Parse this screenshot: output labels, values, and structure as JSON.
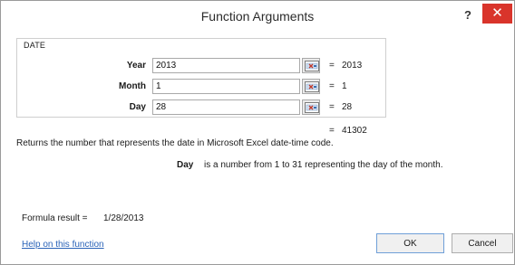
{
  "window": {
    "title": "Function Arguments",
    "help_glyph": "?",
    "close_glyph": "✕"
  },
  "function": {
    "name": "DATE",
    "args": [
      {
        "label": "Year",
        "value": "2013",
        "eq": "=",
        "result": "2013"
      },
      {
        "label": "Month",
        "value": "1",
        "eq": "=",
        "result": "1"
      },
      {
        "label": "Day",
        "value": "28",
        "eq": "=",
        "result": "28"
      }
    ],
    "total_eq": "=",
    "total_result": "41302",
    "description": "Returns the number that represents the date in Microsoft Excel date-time code.",
    "arg_help_name": "Day",
    "arg_help_text": "is a number from 1 to 31 representing the day of the month."
  },
  "formula": {
    "label": "Formula result =",
    "value": "1/28/2013"
  },
  "footer": {
    "help_link": "Help on this function",
    "ok_label": "OK",
    "cancel_label": "Cancel"
  },
  "icons": {
    "ref_button": "range-selector-icon"
  },
  "colors": {
    "close_button": "#d9342b",
    "link": "#2a63b8",
    "ok_border": "#6f9fd8"
  }
}
